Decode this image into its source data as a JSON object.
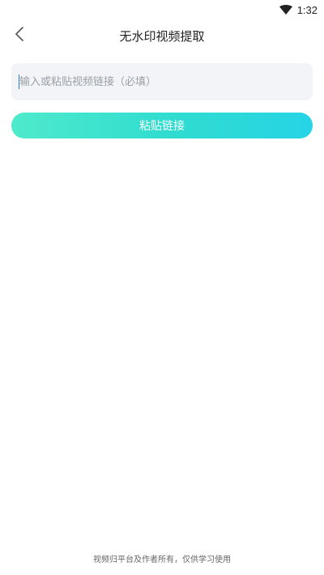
{
  "status_bar": {
    "time": "1:32",
    "icons": [
      "wifi-icon"
    ]
  },
  "nav": {
    "back_icon": "chevron-left-icon",
    "title": "无水印视频提取"
  },
  "link_input": {
    "placeholder": "输入或粘贴视频链接（必填）",
    "value": ""
  },
  "paste_button": {
    "label": "粘贴链接",
    "gradient": [
      "#4eeacc",
      "#26d4e6"
    ]
  },
  "footer": {
    "note": "视频归平台及作者所有，仅供学习使用"
  }
}
